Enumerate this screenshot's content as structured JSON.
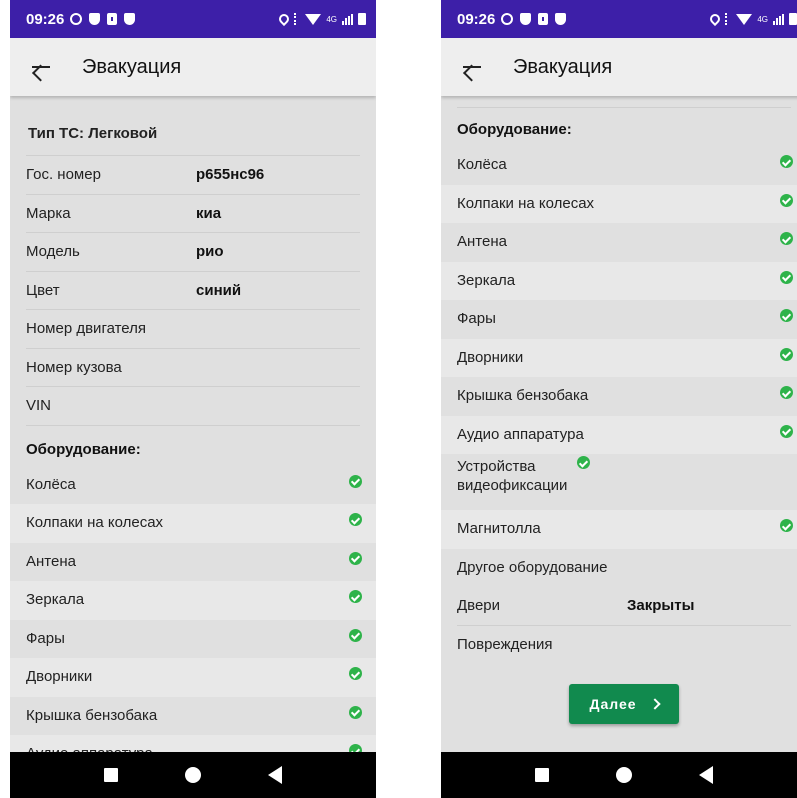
{
  "status_bar": {
    "time": "09:26",
    "network": "4G"
  },
  "app_bar": {
    "title": "Эвакуация"
  },
  "vehicle": {
    "type_label": "Тип ТС: Легковой",
    "fields": [
      {
        "label": "Гос. номер",
        "value": "р655нс96"
      },
      {
        "label": "Марка",
        "value": "киа"
      },
      {
        "label": "Модель",
        "value": "рио"
      },
      {
        "label": "Цвет",
        "value": "синий"
      },
      {
        "label": "Номер двигателя",
        "value": ""
      },
      {
        "label": "Номер кузова",
        "value": ""
      },
      {
        "label": "VIN",
        "value": ""
      }
    ]
  },
  "equipment": {
    "heading": "Оборудование:",
    "items": [
      {
        "label": "Колёса",
        "checked": true
      },
      {
        "label": "Колпаки на колесах",
        "checked": true
      },
      {
        "label": "Антена",
        "checked": true
      },
      {
        "label": "Зеркала",
        "checked": true
      },
      {
        "label": "Фары",
        "checked": true
      },
      {
        "label": "Дворники",
        "checked": true
      },
      {
        "label": "Крышка бензобака",
        "checked": true
      },
      {
        "label": "Аудио аппаратура",
        "checked": true
      },
      {
        "label": "Устройства видеофиксации",
        "checked": true
      },
      {
        "label": "Магнитолла",
        "checked": true
      },
      {
        "label": "Другое оборудование",
        "checked": false
      }
    ]
  },
  "doors": {
    "label": "Двери",
    "value": "Закрыты"
  },
  "damage": {
    "label": "Повреждения"
  },
  "next_button": {
    "label": "Далее"
  },
  "colors": {
    "status_bar": "#3d1fa8",
    "accent_green": "#118a4e",
    "check_green": "#2eb34a"
  }
}
